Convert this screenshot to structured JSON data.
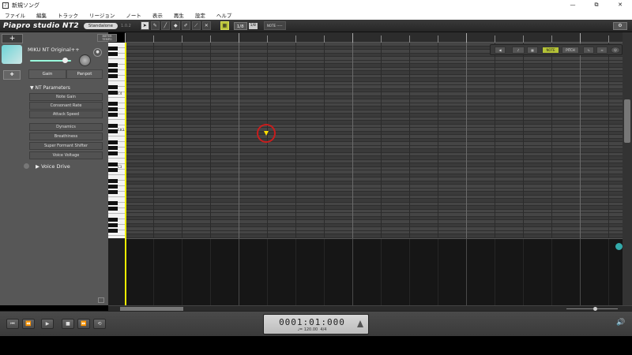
{
  "window": {
    "title": "新規ソング",
    "controls": [
      "—",
      "⧉",
      "✕"
    ]
  },
  "menu": [
    "ファイル",
    "編集",
    "トラック",
    "リージョン",
    "ノート",
    "表示",
    "再生",
    "設定",
    "ヘルプ"
  ],
  "toolbar": {
    "logo": "Piapro studio NT2",
    "mode": "Standalone",
    "version": "1.0.2",
    "tools": [
      "arrow-icon",
      "pencil-icon",
      "line-icon",
      "eraser-icon",
      "brush-icon",
      "knife-icon",
      "cross-icon"
    ],
    "snap_label": "1/8",
    "quantize_display": "1/8",
    "note_preset_label": "NOTE -----"
  },
  "track": {
    "add_label": "+",
    "singer_name": "MIKU NT Original++",
    "buttons": [
      "Gain",
      "Panpot"
    ],
    "parameters_header": "NT Parameters",
    "params1": [
      "Note Gain",
      "Consonant Rate",
      "Attack Speed"
    ],
    "params2": [
      "Dynamics",
      "Breathiness",
      "Super Formant Shifter",
      "Voice Voltage"
    ],
    "voice_drive": "Voice Drive"
  },
  "editor": {
    "meter_label": "METER TEMPO",
    "key_labels": [
      "C4",
      "F#3",
      "C3"
    ],
    "note_tab": "NOTE",
    "pitch_tab": "PITCH"
  },
  "transport": {
    "buttons": [
      "⏮",
      "⏪",
      "▶",
      "■",
      "⏩",
      "⟲"
    ],
    "timecode": "0001:01:000",
    "tempo": "♩= 120.00",
    "signature": "4/4"
  },
  "colors": {
    "accent": "#b5c337",
    "playhead": "#f0f000",
    "grid_light": "#454545",
    "grid_dark": "#3a3a3a"
  }
}
